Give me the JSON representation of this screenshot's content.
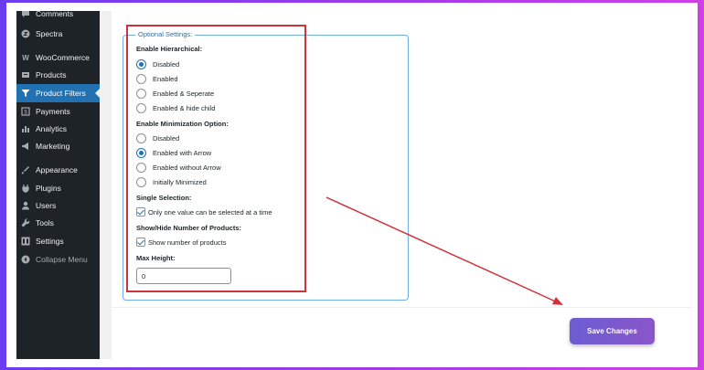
{
  "sidebar": {
    "items": [
      {
        "label": "Comments",
        "icon": "comments-icon"
      },
      {
        "label": "Spectra",
        "icon": "spectra-icon"
      },
      {
        "label": "WooCommerce",
        "icon": "woocommerce-icon"
      },
      {
        "label": "Products",
        "icon": "products-icon"
      },
      {
        "label": "Product Filters",
        "icon": "filter-icon"
      },
      {
        "label": "Payments",
        "icon": "payments-icon"
      },
      {
        "label": "Analytics",
        "icon": "analytics-icon"
      },
      {
        "label": "Marketing",
        "icon": "marketing-icon"
      },
      {
        "label": "Appearance",
        "icon": "appearance-icon"
      },
      {
        "label": "Plugins",
        "icon": "plugins-icon"
      },
      {
        "label": "Users",
        "icon": "users-icon"
      },
      {
        "label": "Tools",
        "icon": "tools-icon"
      },
      {
        "label": "Settings",
        "icon": "settings-icon"
      },
      {
        "label": "Collapse Menu",
        "icon": "collapse-icon"
      }
    ],
    "active": "Product Filters"
  },
  "optional_settings": {
    "legend": "Optional Settings:",
    "hierarchical": {
      "label": "Enable Hierarchical:",
      "options": [
        "Disabled",
        "Enabled",
        "Enabled & Seperate",
        "Enabled & hide child"
      ],
      "selected": "Disabled"
    },
    "minimization": {
      "label": "Enable Minimization Option:",
      "options": [
        "Disabled",
        "Enabled with Arrow",
        "Enabled without Arrow",
        "Initially Minimized"
      ],
      "selected": "Enabled with Arrow"
    },
    "single_selection": {
      "label": "Single Selection:",
      "checkbox_label": "Only one value can be selected at a time",
      "checked": true
    },
    "show_hide_products": {
      "label": "Show/Hide Number of Products:",
      "checkbox_label": "Show number of products",
      "checked": true
    },
    "max_height": {
      "label": "Max Height:",
      "value": "0"
    }
  },
  "save_button": {
    "label": "Save Changes"
  },
  "colors": {
    "sidebar_bg": "#1d2327",
    "active_item": "#2271b1",
    "annotation_red": "#d0313b",
    "save_button": "#7659cf"
  }
}
